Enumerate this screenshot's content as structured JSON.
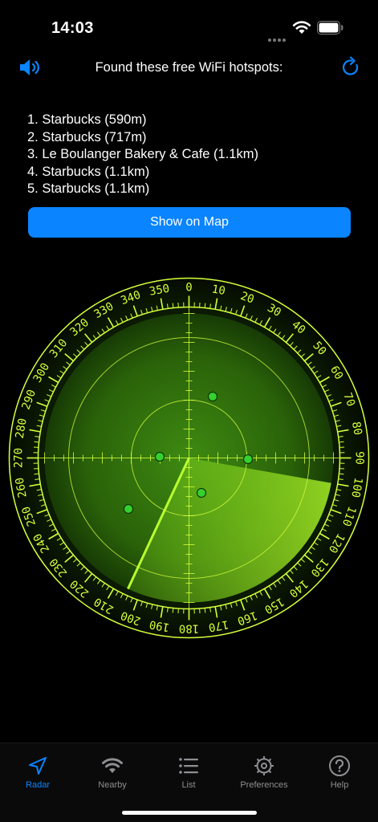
{
  "status_bar": {
    "time": "14:03"
  },
  "header": {
    "title": "Found these free WiFi hotspots:",
    "speaker_icon": "speaker-icon",
    "refresh_icon": "refresh-icon"
  },
  "hotspots": [
    "1. Starbucks (590m)",
    "2. Starbucks (717m)",
    "3. Le Boulanger Bakery & Cafe (1.1km)",
    "4. Starbucks (1.1km)",
    "5. Starbucks (1.1km)"
  ],
  "map_button": {
    "label": "Show on Map"
  },
  "radar": {
    "dial_labels": [
      "0",
      "10",
      "20",
      "30",
      "40",
      "50",
      "60",
      "70",
      "80",
      "90",
      "100",
      "110",
      "120",
      "130",
      "140",
      "150",
      "160",
      "170",
      "180",
      "190",
      "200",
      "210",
      "220",
      "230",
      "240",
      "250",
      "260",
      "270",
      "280",
      "290",
      "300",
      "310",
      "320",
      "330",
      "340",
      "350"
    ],
    "colors": {
      "dial": "#d4ff3c",
      "screen": "#2f6b0c",
      "sweep": "#b8ff30",
      "blip": "#35d12f"
    }
  },
  "tabs": [
    {
      "label": "Radar",
      "icon": "navigation-arrow-icon",
      "active": true
    },
    {
      "label": "Nearby",
      "icon": "wifi-icon",
      "active": false
    },
    {
      "label": "List",
      "icon": "list-icon",
      "active": false
    },
    {
      "label": "Preferences",
      "icon": "gear-icon",
      "active": false
    },
    {
      "label": "Help",
      "icon": "help-icon",
      "active": false
    }
  ],
  "colors": {
    "accent": "#0a84ff",
    "background": "#000000"
  }
}
